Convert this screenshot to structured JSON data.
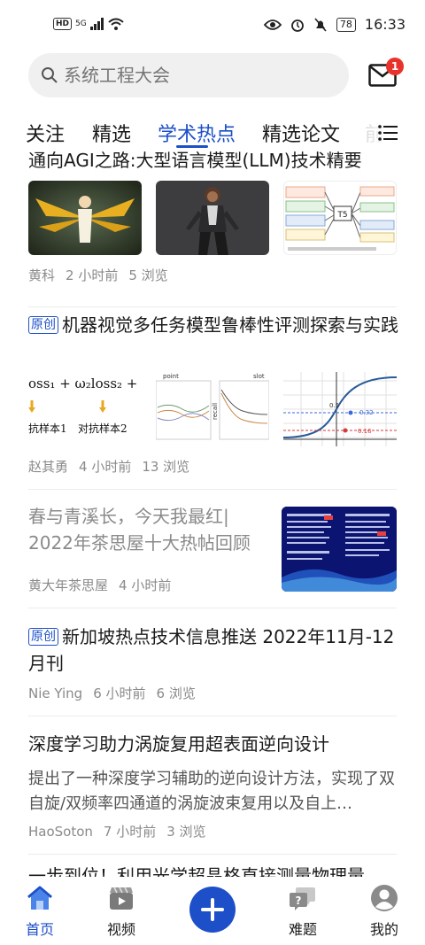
{
  "status_bar": {
    "hd_label": "HD",
    "network": "5G",
    "battery": "78",
    "time": "16:33"
  },
  "search": {
    "placeholder": "系统工程大会"
  },
  "mail": {
    "badge_count": "1"
  },
  "tabs": [
    {
      "label": "关注",
      "active": false
    },
    {
      "label": "精选",
      "active": false
    },
    {
      "label": "学术热点",
      "active": true
    },
    {
      "label": "精选论文",
      "active": false
    },
    {
      "label": "前",
      "active": false
    }
  ],
  "feed": [
    {
      "title": "通向AGI之路:大型语言模型(LLM)技术精要",
      "author": "黄科",
      "time": "2 小时前",
      "views": "5 浏览",
      "thumbs": [
        "mercy-render-thumbnail",
        "female-character-render-thumbnail",
        "t5-diagram-thumbnail"
      ]
    },
    {
      "tag": "原创",
      "title": "机器视觉多任务模型鲁棒性评测探索与实践",
      "author": "赵其勇",
      "time": "4 小时前",
      "views": "13 浏览",
      "thumbs": [
        "loss-formula-thumbnail",
        "recall-chart-thumbnail",
        "sigmoid-chart-thumbnail"
      ],
      "thumb_text": {
        "formula": "oss₁ + ω₂loss₂ + ·",
        "label_a": "抗样本1",
        "label_b": "对抗样本2",
        "chart_left": "point",
        "chart_right": "slot",
        "recall_label": "recall",
        "val_1": "0.32",
        "val_2": "0.16",
        "val_3": "0.5"
      }
    },
    {
      "title": "春与青溪长，今天我最红| 2022年茶思屋十大热帖回顾",
      "title_style": "gray",
      "author": "黄大年茶思屋",
      "time": "4 小时前",
      "thumbs": [
        "tea-house-slide-thumbnail"
      ]
    },
    {
      "tag": "原创",
      "title": "新加坡热点技术信息推送 2022年11月-12月刊",
      "author": "Nie Ying",
      "time": "6 小时前",
      "views": "6 浏览"
    },
    {
      "title": "深度学习助力涡旋复用超表面逆向设计",
      "summary": "提出了一种深度学习辅助的逆向设计方法，实现了双自旋/双频率四通道的涡旋波束复用以及自上…",
      "author": "HaoSoton",
      "time": "7 小时前",
      "views": "3 浏览"
    },
    {
      "title": "一步到位！利用光学超晶格直接测量物理量"
    }
  ],
  "bottom_nav": [
    {
      "label": "首页",
      "icon": "home-icon",
      "active": true
    },
    {
      "label": "视频",
      "icon": "video-icon",
      "active": false
    },
    {
      "label": "",
      "icon": "plus-icon",
      "active": false
    },
    {
      "label": "难题",
      "icon": "question-bubble-icon",
      "active": false
    },
    {
      "label": "我的",
      "icon": "profile-icon",
      "active": false
    }
  ],
  "colors": {
    "accent": "#1d4fc8",
    "badge": "#e8332d",
    "meta_text": "#8a8a8a"
  }
}
